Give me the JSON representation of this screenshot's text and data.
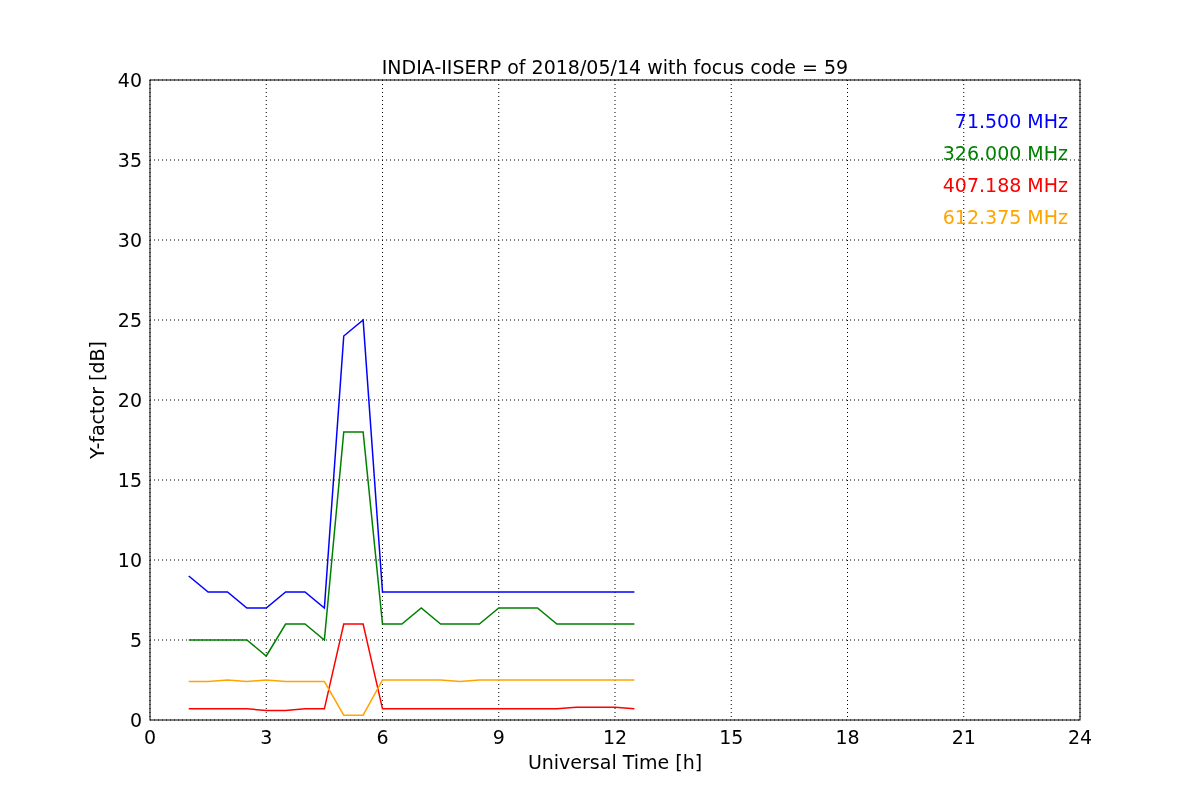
{
  "chart_data": {
    "type": "line",
    "title": "INDIA-IISERP of 2018/05/14 with focus code = 59",
    "xlabel": "Universal Time [h]",
    "ylabel": "Y-factor [dB]",
    "x": [
      1,
      1.5,
      2,
      2.5,
      3,
      3.5,
      4,
      4.5,
      5,
      5.5,
      6,
      6.5,
      7,
      7.5,
      8,
      8.5,
      9,
      9.5,
      10,
      10.5,
      11,
      11.5,
      12,
      12.5
    ],
    "series": [
      {
        "name": "71.500 MHz",
        "color": "#0000ff",
        "values": [
          9,
          8,
          8,
          7,
          7,
          8,
          8,
          7,
          24,
          25,
          8,
          8,
          8,
          8,
          8,
          8,
          8,
          8,
          8,
          8,
          8,
          8,
          8,
          8
        ]
      },
      {
        "name": "326.000 MHz",
        "color": "#008000",
        "values": [
          5,
          5,
          5,
          5,
          4,
          6,
          6,
          5,
          18,
          18,
          6,
          6,
          7,
          6,
          6,
          6,
          7,
          7,
          7,
          6,
          6,
          6,
          6,
          6
        ]
      },
      {
        "name": "407.188 MHz",
        "color": "#ff0000",
        "values": [
          0.7,
          0.7,
          0.7,
          0.7,
          0.6,
          0.6,
          0.7,
          0.7,
          6,
          6,
          0.7,
          0.7,
          0.7,
          0.7,
          0.7,
          0.7,
          0.7,
          0.7,
          0.7,
          0.7,
          0.8,
          0.8,
          0.8,
          0.7
        ]
      },
      {
        "name": "612.375 MHz",
        "color": "#ffa500",
        "values": [
          2.4,
          2.4,
          2.5,
          2.4,
          2.5,
          2.4,
          2.4,
          2.4,
          0.3,
          0.3,
          2.5,
          2.5,
          2.5,
          2.5,
          2.4,
          2.5,
          2.5,
          2.5,
          2.5,
          2.5,
          2.5,
          2.5,
          2.5,
          2.5
        ]
      }
    ],
    "grid": true,
    "xlim": [
      0,
      24
    ],
    "ylim": [
      0,
      40
    ],
    "xticks": [
      0,
      3,
      6,
      9,
      12,
      15,
      18,
      21,
      24
    ],
    "yticks": [
      0,
      5,
      10,
      15,
      20,
      25,
      30,
      35,
      40
    ]
  }
}
